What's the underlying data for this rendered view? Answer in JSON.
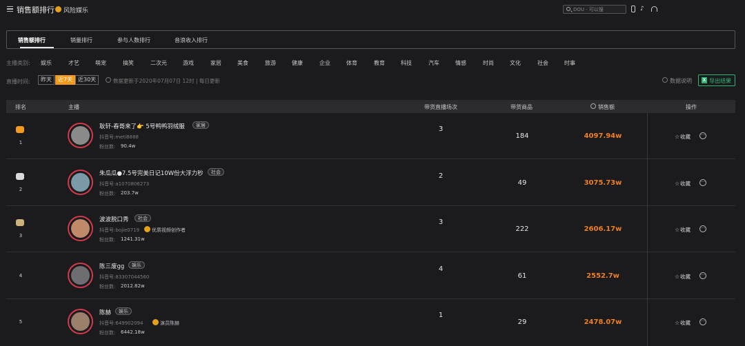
{
  "header": {
    "title": "销售额排行",
    "brand_name": "风险媒乐",
    "search_placeholder": "DOU · 可以搜",
    "icons": [
      "menu-icon",
      "phone-icon",
      "tiktok-icon",
      "headset-icon"
    ]
  },
  "tabs": [
    {
      "label": "销售额排行",
      "active": true
    },
    {
      "label": "销量排行",
      "active": false
    },
    {
      "label": "参与人数排行",
      "active": false
    },
    {
      "label": "音浪收入排行",
      "active": false
    }
  ],
  "categories": {
    "label": "主播类别:",
    "items": [
      "娱乐",
      "才艺",
      "萌宠",
      "搞笑",
      "二次元",
      "游戏",
      "家居",
      "美食",
      "旅游",
      "健康",
      "企业",
      "体育",
      "教育",
      "科技",
      "汽车",
      "情感",
      "时尚",
      "文化",
      "社会",
      "时事"
    ]
  },
  "filters": {
    "time_label": "直播时间:",
    "options": [
      {
        "label": "昨天",
        "active": false
      },
      {
        "label": "近7天",
        "active": true
      },
      {
        "label": "近30天",
        "active": false
      }
    ],
    "update_text": "数据更新于2020年07月07日 12时 | 每日更新",
    "help_label": "数据说明",
    "export_label": "导出结果"
  },
  "table": {
    "headers": {
      "rank": "排名",
      "anchor": "主播",
      "sessions": "带货直播场次",
      "goods": "带货商品",
      "sales": "销售额",
      "actions": "操作"
    },
    "fav_label": "收藏",
    "account_prefix": "抖音号:",
    "fans_prefix": "粉丝数:",
    "rows": [
      {
        "rank": "1",
        "medal": "#f39a1c",
        "name": "耿轩-春哥来了👉 5号鸭鸭羽绒服",
        "tag": "家居",
        "account": "meti8888",
        "creator": "",
        "fans": "90.4w",
        "sessions": "3",
        "goods": "184",
        "sales": "4097.94w"
      },
      {
        "rank": "2",
        "medal": "#d9d9d9",
        "name": "朱瓜瓜●7.5号完美日记10W份大浮力秒",
        "tag": "社会",
        "account": "a1070806273",
        "creator": "",
        "fans": "203.7w",
        "sessions": "2",
        "goods": "49",
        "sales": "3075.73w"
      },
      {
        "rank": "3",
        "medal": "#cdb27e",
        "name": "波波脱口秀",
        "tag": "社会",
        "account": "bojie0719",
        "creator": "优质视频创作者",
        "fans": "1241.31w",
        "sessions": "3",
        "goods": "222",
        "sales": "2606.17w"
      },
      {
        "rank": "4",
        "medal": "",
        "name": "陈三废gg",
        "tag": "娱乐",
        "account": "83307044560",
        "creator": "",
        "fans": "2012.82w",
        "sessions": "4",
        "goods": "61",
        "sales": "2552.7w"
      },
      {
        "rank": "5",
        "medal": "",
        "name": "陈赫",
        "tag": "娱乐",
        "account": "649902094",
        "creator": "演员陈赫",
        "fans": "6442.18w",
        "sessions": "1",
        "goods": "29",
        "sales": "2478.07w"
      }
    ]
  }
}
